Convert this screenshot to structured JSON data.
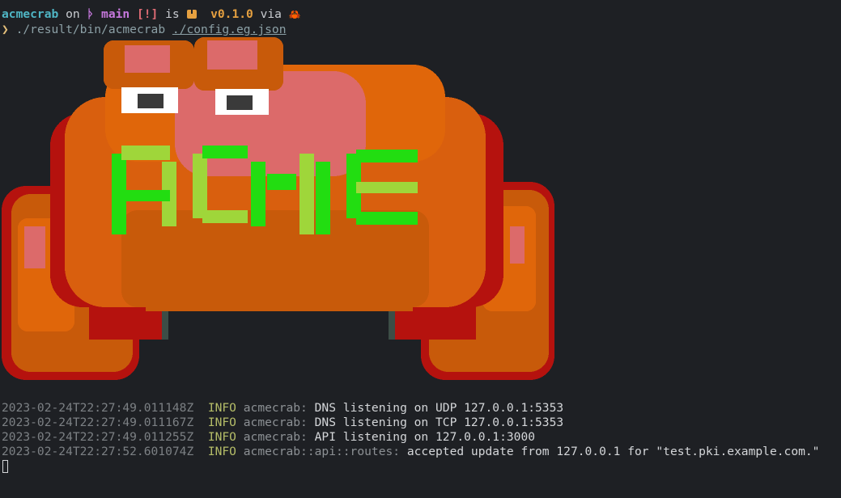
{
  "prompt": {
    "directory": "acmecrab",
    "on": "on",
    "branch_icon": "git-branch-icon",
    "branch_glyph": "ᚦ",
    "branch": "main",
    "status": "[!]",
    "is": "is",
    "package_icon": "package-icon",
    "version": "v0.1.0",
    "via": "via",
    "rust_icon": "crab-icon",
    "rust_glyph": "🦀"
  },
  "command": {
    "prompt_symbol": "❯",
    "executable": "./result/bin/acmecrab",
    "argument": "./config.eg.json"
  },
  "logo": {
    "icon": "acmecrab-pixel-crab-logo",
    "lettering": "ACME"
  },
  "logs": [
    {
      "timestamp": "2023-02-24T22:27:49.011148Z",
      "level": "INFO",
      "target": "acmecrab:",
      "message": "DNS listening on UDP 127.0.0.1:5353"
    },
    {
      "timestamp": "2023-02-24T22:27:49.011167Z",
      "level": "INFO",
      "target": "acmecrab:",
      "message": "DNS listening on TCP 127.0.0.1:5353"
    },
    {
      "timestamp": "2023-02-24T22:27:49.011255Z",
      "level": "INFO",
      "target": "acmecrab:",
      "message": "API listening on 127.0.0.1:3000"
    },
    {
      "timestamp": "2023-02-24T22:27:52.601074Z",
      "level": "INFO",
      "target": "acmecrab::api::routes:",
      "message": "accepted update from 127.0.0.1 for \"test.pki.example.com.\""
    }
  ],
  "colors": {
    "background": "#1e2024",
    "shell_orange": "#d95f0e",
    "shell_dark": "#b85c0a",
    "shell_red": "#b5120e",
    "pink": "#dc6a6a",
    "green": "#22dd11",
    "lime": "#9fd63a",
    "outline": "#7fc0a8"
  }
}
